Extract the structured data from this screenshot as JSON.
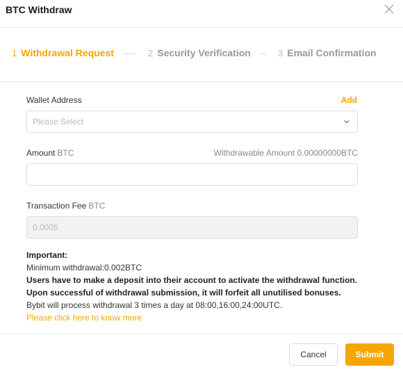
{
  "dialog": {
    "title": "BTC Withdraw",
    "close_icon": "close-icon"
  },
  "steps": [
    {
      "number": "1",
      "label": "Withdrawal Request",
      "active": true
    },
    {
      "number": "2",
      "label": "Security Verification",
      "active": false
    },
    {
      "number": "3",
      "label": "Email Confirmation",
      "active": false
    }
  ],
  "form": {
    "wallet_address": {
      "label": "Wallet Address",
      "add_label": "Add",
      "placeholder": "Please Select",
      "icon": "chevron-down-icon"
    },
    "amount": {
      "label": "Amount",
      "unit": "BTC",
      "withdrawable_label": "Withdrawable Amount",
      "withdrawable_value": "0.00000000BTC",
      "value": ""
    },
    "fee": {
      "label": "Transaction Fee",
      "unit": "BTC",
      "value": "0.0005"
    }
  },
  "notes": {
    "heading": "Important:",
    "min_withdrawal": "Minimum withdrawal:0.002BTC",
    "deposit_note": "Users have to make a deposit into their account to activate the withdrawal function.",
    "bonus_note": "Upon successful of withdrawal submission, it will forfeit all unutilised bonuses.",
    "schedule_note": "Bybit will process withdrawal 3 times a day at 08:00,16:00,24:00UTC.",
    "more_link": "Please click here to know more"
  },
  "footer": {
    "cancel_label": "Cancel",
    "submit_label": "Submit"
  },
  "colors": {
    "accent": "#f7a600",
    "muted": "#999999"
  }
}
